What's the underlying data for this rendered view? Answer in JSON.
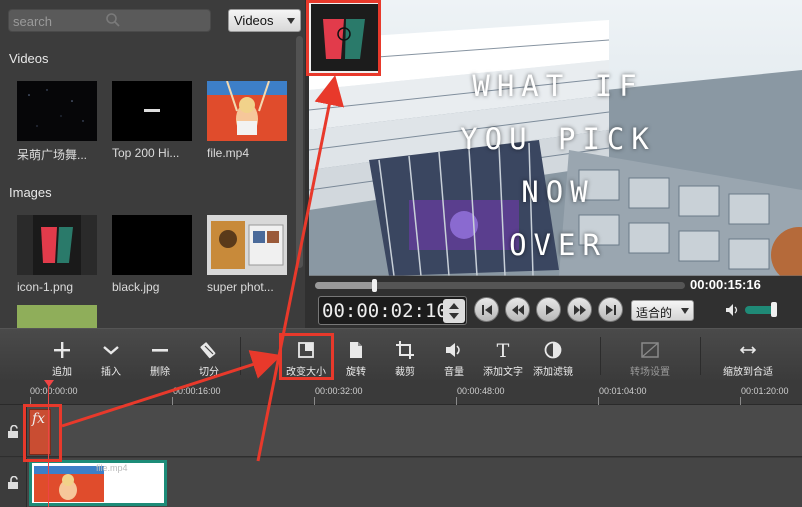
{
  "library": {
    "search": {
      "placeholder": "search"
    },
    "type_filter": {
      "selected": "Videos"
    },
    "videos_title": "Videos",
    "videos": [
      {
        "label": "呆萌广场舞..."
      },
      {
        "label": "Top 200 Hi..."
      },
      {
        "label": "file.mp4"
      }
    ],
    "images_title": "Images",
    "images": [
      {
        "label": "icon-1.png"
      },
      {
        "label": "black.jpg"
      },
      {
        "label": "super phot..."
      }
    ]
  },
  "preview": {
    "overlay_lines": [
      "WHAT IF",
      "YOU PICK NOW",
      "OVER NEVER?"
    ],
    "progress_fraction": 0.16,
    "duration": "00:00:15:16",
    "timecode": "00:00:02:10",
    "zoom_select": "适合的",
    "volume_fraction": 0.85
  },
  "toolbar": {
    "add": "追加",
    "insert": "插入",
    "delete": "删除",
    "split": "切分",
    "resize": "改变大小",
    "rotate": "旋转",
    "crop": "裁剪",
    "volume": "音量",
    "add_text": "添加文字",
    "add_filter": "添加滤镜",
    "transition": "转场设置",
    "zoom_fit": "缩放到合适"
  },
  "ruler": {
    "ticks": [
      "00:00:00:00",
      "00:00:16:00",
      "00:00:32:00",
      "00:00:48:00",
      "00:01:04:00",
      "00:01:20:00"
    ]
  },
  "timeline": {
    "fx_clip": "fx",
    "video_clip_name": "file.mp4"
  },
  "colors": {
    "annotation": "#e8392b",
    "accent": "#1d8c78"
  }
}
